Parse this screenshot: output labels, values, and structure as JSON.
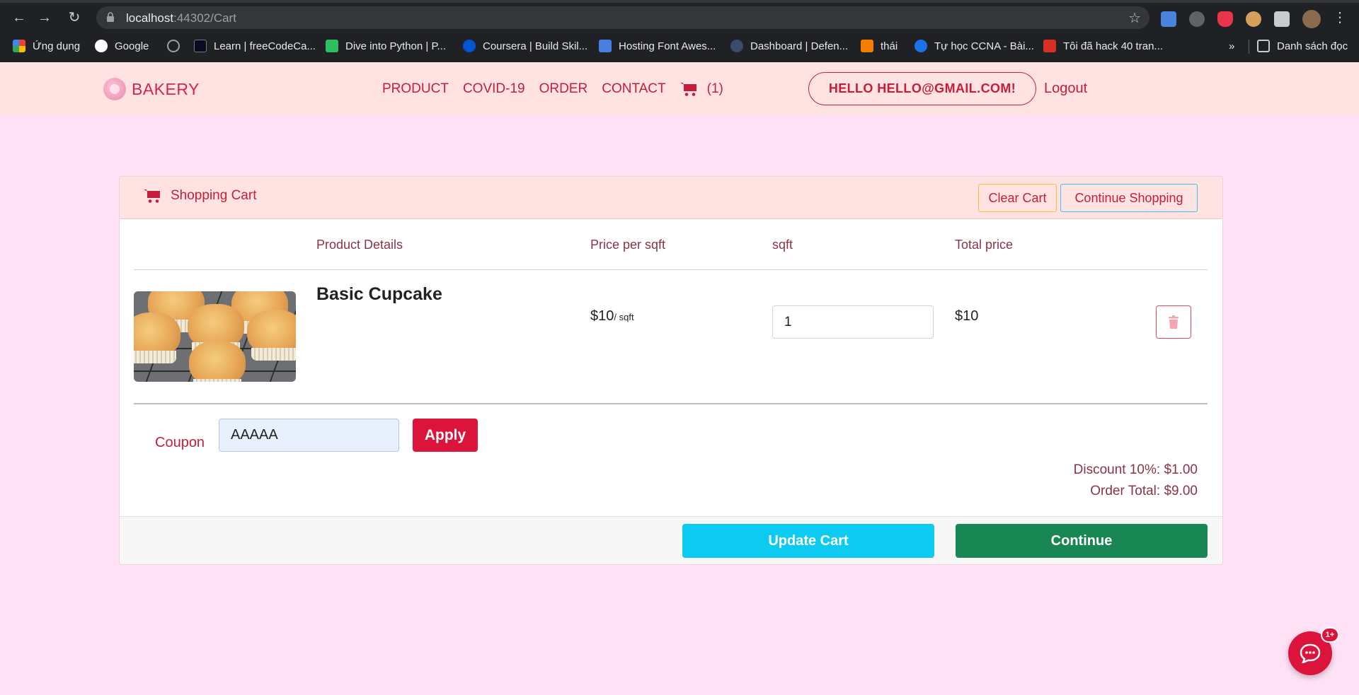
{
  "browser": {
    "url_host": "localhost",
    "url_rest": ":44302/Cart",
    "bookmarks": [
      {
        "label": "Ứng dụng",
        "icon": "apps-grid-icon",
        "color": "#ea4335"
      },
      {
        "label": "Google",
        "icon": "google-icon",
        "color": "#ffffff"
      },
      {
        "label": "",
        "icon": "history-icon",
        "color": "#9aa0a6"
      },
      {
        "label": "Learn | freeCodeCa...",
        "icon": "freecodecamp-icon",
        "color": "#0a0a23"
      },
      {
        "label": "Dive into Python | P...",
        "icon": "diveintopython-icon",
        "color": "#2dbe60"
      },
      {
        "label": "Coursera | Build Skil...",
        "icon": "coursera-icon",
        "color": "#0056d2"
      },
      {
        "label": "Hosting Font Awes...",
        "icon": "flag-icon",
        "color": "#4a7ee0"
      },
      {
        "label": "Dashboard | Defen...",
        "icon": "globe-icon",
        "color": "#3c4a6b"
      },
      {
        "label": "thái",
        "icon": "blogger-icon",
        "color": "#f57d00"
      },
      {
        "label": "Tự học CCNA - Bài...",
        "icon": "ccna-icon",
        "color": "#1a73e8"
      },
      {
        "label": "Tôi đã hack 40 tran...",
        "icon": "t-icon",
        "color": "#d93025"
      }
    ],
    "reading_list": "Danh sách đọc",
    "more_bookmarks": "»"
  },
  "navbar": {
    "brand": "BAKERY",
    "links": [
      "PRODUCT",
      "COVID-19",
      "ORDER",
      "CONTACT"
    ],
    "cart_count": "(1)",
    "greeting": "HELLO HELLO@GMAIL.COM!",
    "logout": "Logout"
  },
  "cart": {
    "title": "Shopping Cart",
    "clear_label": "Clear Cart",
    "continue_shopping_label": "Continue Shopping",
    "columns": [
      "Product Details",
      "Price per sqft",
      "sqft",
      "Total price"
    ],
    "items": [
      {
        "name": "Basic Cupcake",
        "price": "$10",
        "unit": "/ sqft",
        "qty": "1",
        "total": "$10"
      }
    ],
    "coupon_label": "Coupon",
    "coupon_value": "AAAAA",
    "apply_label": "Apply",
    "discount": "Discount 10%: $1.00",
    "order_total": "Order Total: $9.00",
    "update_label": "Update Cart",
    "continue_label": "Continue"
  },
  "chat": {
    "badge": "1+"
  },
  "colors": {
    "page_bg": "#ffe0f5",
    "navbar_bg": "#ffe3e3",
    "accent": "#dc143c",
    "update_btn": "#0dcaf0",
    "continue_btn": "#198754"
  }
}
